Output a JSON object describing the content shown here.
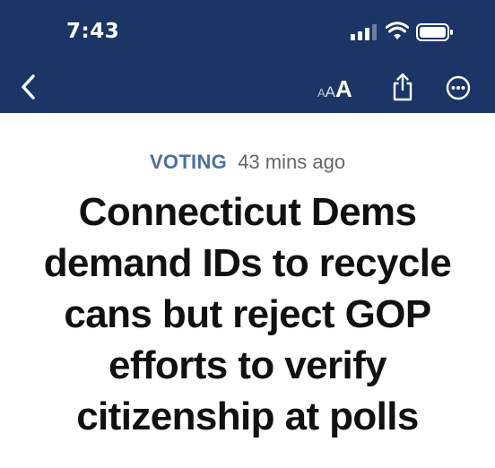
{
  "status_bar": {
    "time": "7:43"
  },
  "nav": {
    "back_icon": "chevron-left-icon",
    "text_size_label": {
      "small": "A",
      "medium": "A",
      "large": "A"
    },
    "share_icon": "share-icon",
    "more_icon": "more-icon"
  },
  "article": {
    "category": "VOTING",
    "time_ago": "43 mins ago",
    "headline_lines": [
      "Connecticut Dems",
      "demand IDs to recycle",
      "cans but reject GOP",
      "efforts to verify",
      "citizenship at polls"
    ]
  },
  "colors": {
    "header_bg": "#1a3566",
    "category": "#4b6fa6",
    "headline": "#111111"
  }
}
